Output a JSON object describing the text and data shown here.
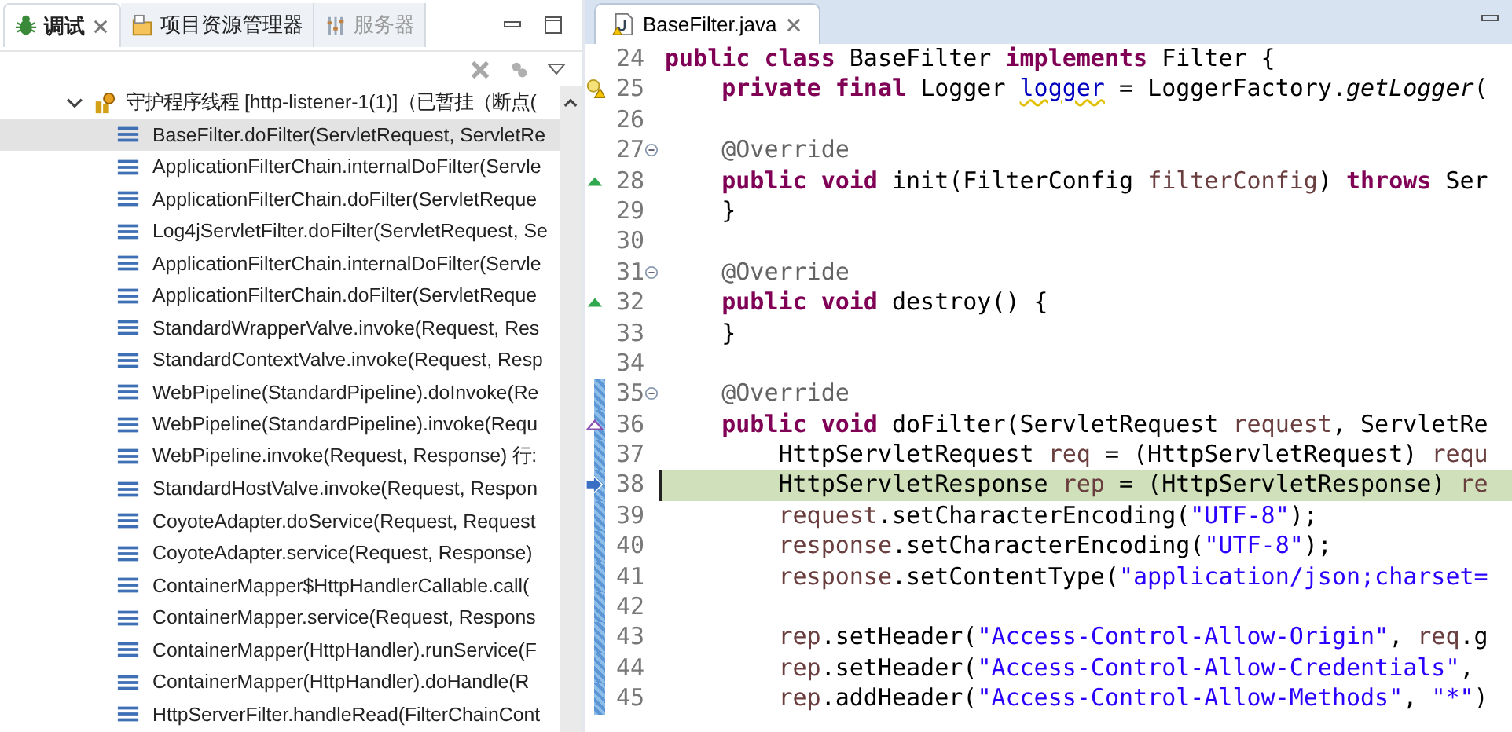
{
  "debug_view": {
    "tabs": [
      {
        "label": "调试",
        "selected": true,
        "closable": true
      },
      {
        "label": "项目资源管理器",
        "selected": false,
        "closable": false
      },
      {
        "label": "服务器",
        "selected": false,
        "closable": false
      }
    ],
    "thread": {
      "label": "守护程序线程 [http-listener-1(1)]（已暂挂（断点(",
      "expanded": true,
      "frames": [
        {
          "label": "BaseFilter.doFilter(ServletRequest, ServletRe",
          "selected": true
        },
        {
          "label": "ApplicationFilterChain.internalDoFilter(Servle",
          "selected": false
        },
        {
          "label": "ApplicationFilterChain.doFilter(ServletReque",
          "selected": false
        },
        {
          "label": "Log4jServletFilter.doFilter(ServletRequest, Se",
          "selected": false
        },
        {
          "label": "ApplicationFilterChain.internalDoFilter(Servle",
          "selected": false
        },
        {
          "label": "ApplicationFilterChain.doFilter(ServletReque",
          "selected": false
        },
        {
          "label": "StandardWrapperValve.invoke(Request, Res",
          "selected": false
        },
        {
          "label": "StandardContextValve.invoke(Request, Resp",
          "selected": false
        },
        {
          "label": "WebPipeline(StandardPipeline).doInvoke(Re",
          "selected": false
        },
        {
          "label": "WebPipeline(StandardPipeline).invoke(Requ",
          "selected": false
        },
        {
          "label": "WebPipeline.invoke(Request, Response) 行:",
          "selected": false
        },
        {
          "label": "StandardHostValve.invoke(Request, Respon",
          "selected": false
        },
        {
          "label": "CoyoteAdapter.doService(Request, Request",
          "selected": false
        },
        {
          "label": "CoyoteAdapter.service(Request, Response)",
          "selected": false
        },
        {
          "label": "ContainerMapper$HttpHandlerCallable.call(",
          "selected": false
        },
        {
          "label": "ContainerMapper.service(Request, Respons",
          "selected": false
        },
        {
          "label": "ContainerMapper(HttpHandler).runService(F",
          "selected": false
        },
        {
          "label": "ContainerMapper(HttpHandler).doHandle(R",
          "selected": false
        },
        {
          "label": "HttpServerFilter.handleRead(FilterChainCont",
          "selected": false
        }
      ]
    }
  },
  "editor": {
    "tab": {
      "label": "BaseFilter.java",
      "selected": true
    },
    "lines": [
      {
        "number": "24",
        "kind": "code",
        "in_range": false,
        "current": false,
        "tokens": [
          {
            "kind": "kw",
            "text": "public class "
          },
          {
            "kind": "plain",
            "text": "BaseFilter "
          },
          {
            "kind": "kw",
            "text": "implements "
          },
          {
            "kind": "plain",
            "text": "Filter {"
          }
        ]
      },
      {
        "number": "25",
        "kind": "warning",
        "in_range": false,
        "current": false,
        "tokens": [
          {
            "kind": "kw",
            "text": "    private final "
          },
          {
            "kind": "plain",
            "text": "Logger "
          },
          {
            "kind": "field-warning",
            "text": "logger"
          },
          {
            "kind": "plain",
            "text": " = LoggerFactory."
          },
          {
            "kind": "static",
            "text": "getLogger"
          },
          {
            "kind": "plain",
            "text": "("
          }
        ]
      },
      {
        "number": "26",
        "kind": "code",
        "in_range": false,
        "current": false
      },
      {
        "number": "27",
        "kind": "fold",
        "in_range": false,
        "current": false,
        "tokens": [
          {
            "kind": "ann",
            "text": "    @Override"
          }
        ]
      },
      {
        "number": "28",
        "kind": "override",
        "in_range": false,
        "current": false,
        "tokens": [
          {
            "kind": "kw",
            "text": "    public void "
          },
          {
            "kind": "plain",
            "text": "init(FilterConfig "
          },
          {
            "kind": "var",
            "text": "filterConfig"
          },
          {
            "kind": "plain",
            "text": ") "
          },
          {
            "kind": "kw",
            "text": "throws "
          },
          {
            "kind": "plain",
            "text": "Ser"
          }
        ]
      },
      {
        "number": "29",
        "kind": "code",
        "in_range": false,
        "current": false,
        "tokens": [
          {
            "kind": "plain",
            "text": "    }"
          }
        ]
      },
      {
        "number": "30",
        "kind": "code",
        "in_range": false,
        "current": false
      },
      {
        "number": "31",
        "kind": "fold",
        "in_range": false,
        "current": false,
        "tokens": [
          {
            "kind": "ann",
            "text": "    @Override"
          }
        ]
      },
      {
        "number": "32",
        "kind": "override",
        "in_range": false,
        "current": false,
        "tokens": [
          {
            "kind": "kw",
            "text": "    public void "
          },
          {
            "kind": "plain",
            "text": "destroy() {"
          }
        ]
      },
      {
        "number": "33",
        "kind": "code",
        "in_range": false,
        "current": false,
        "tokens": [
          {
            "kind": "plain",
            "text": "    }"
          }
        ]
      },
      {
        "number": "34",
        "kind": "code",
        "in_range": false,
        "current": false
      },
      {
        "number": "35",
        "kind": "fold",
        "in_range": true,
        "current": false,
        "tokens": [
          {
            "kind": "ann",
            "text": "    @Override"
          }
        ]
      },
      {
        "number": "36",
        "kind": "implements",
        "in_range": true,
        "current": false,
        "tokens": [
          {
            "kind": "kw",
            "text": "    public void "
          },
          {
            "kind": "plain",
            "text": "doFilter(ServletRequest "
          },
          {
            "kind": "var",
            "text": "request"
          },
          {
            "kind": "plain",
            "text": ", ServletRe"
          }
        ]
      },
      {
        "number": "37",
        "kind": "code",
        "in_range": true,
        "current": false,
        "tokens": [
          {
            "kind": "plain",
            "text": "        HttpServletRequest "
          },
          {
            "kind": "var",
            "text": "req"
          },
          {
            "kind": "plain",
            "text": " = (HttpServletRequest) "
          },
          {
            "kind": "var",
            "text": "requ"
          }
        ]
      },
      {
        "number": "38",
        "kind": "instruction",
        "in_range": true,
        "current": true,
        "tokens": [
          {
            "kind": "plain",
            "text": "        HttpServletResponse "
          },
          {
            "kind": "var",
            "text": "rep"
          },
          {
            "kind": "plain",
            "text": " = (HttpServletResponse) "
          },
          {
            "kind": "var",
            "text": "re"
          }
        ]
      },
      {
        "number": "39",
        "kind": "code",
        "in_range": true,
        "current": false,
        "tokens": [
          {
            "kind": "var",
            "text": "        request"
          },
          {
            "kind": "plain",
            "text": ".setCharacterEncoding("
          },
          {
            "kind": "str",
            "text": "\"UTF-8\""
          },
          {
            "kind": "plain",
            "text": ");"
          }
        ]
      },
      {
        "number": "40",
        "kind": "code",
        "in_range": true,
        "current": false,
        "tokens": [
          {
            "kind": "var",
            "text": "        response"
          },
          {
            "kind": "plain",
            "text": ".setCharacterEncoding("
          },
          {
            "kind": "str",
            "text": "\"UTF-8\""
          },
          {
            "kind": "plain",
            "text": ");"
          }
        ]
      },
      {
        "number": "41",
        "kind": "code",
        "in_range": true,
        "current": false,
        "tokens": [
          {
            "kind": "var",
            "text": "        response"
          },
          {
            "kind": "plain",
            "text": ".setContentType("
          },
          {
            "kind": "str",
            "text": "\"application/json;charset="
          }
        ]
      },
      {
        "number": "42",
        "kind": "code",
        "in_range": true,
        "current": false
      },
      {
        "number": "43",
        "kind": "code",
        "in_range": true,
        "current": false,
        "tokens": [
          {
            "kind": "var",
            "text": "        rep"
          },
          {
            "kind": "plain",
            "text": ".setHeader("
          },
          {
            "kind": "str",
            "text": "\"Access-Control-Allow-Origin\""
          },
          {
            "kind": "plain",
            "text": ", "
          },
          {
            "kind": "var",
            "text": "req"
          },
          {
            "kind": "plain",
            "text": ".g"
          }
        ]
      },
      {
        "number": "44",
        "kind": "code",
        "in_range": true,
        "current": false,
        "tokens": [
          {
            "kind": "var",
            "text": "        rep"
          },
          {
            "kind": "plain",
            "text": ".setHeader("
          },
          {
            "kind": "str",
            "text": "\"Access-Control-Allow-Credentials\""
          },
          {
            "kind": "plain",
            "text": ","
          }
        ]
      },
      {
        "number": "45",
        "kind": "code",
        "in_range": true,
        "current": false,
        "tokens": [
          {
            "kind": "var",
            "text": "        rep"
          },
          {
            "kind": "plain",
            "text": ".addHeader("
          },
          {
            "kind": "str",
            "text": "\"Access-Control-Allow-Methods\""
          },
          {
            "kind": "plain",
            "text": ", "
          },
          {
            "kind": "str",
            "text": "\"*\""
          },
          {
            "kind": "plain",
            "text": ")"
          }
        ]
      }
    ]
  }
}
